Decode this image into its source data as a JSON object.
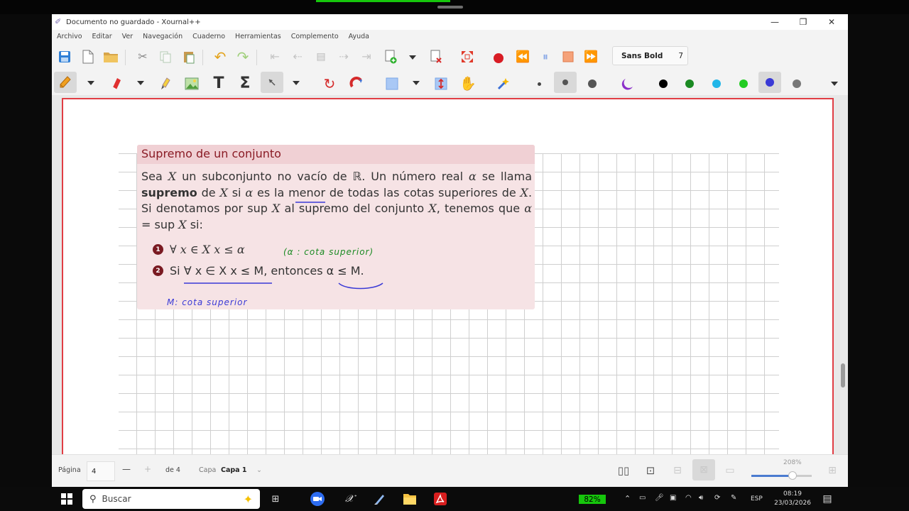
{
  "window": {
    "title": "Documento no guardado - Xournal++",
    "controls": {
      "minimize": "—",
      "restore": "❐",
      "close": "✕"
    }
  },
  "menu": [
    "Archivo",
    "Editar",
    "Ver",
    "Navegación",
    "Cuaderno",
    "Herramientas",
    "Complemento",
    "Ayuda"
  ],
  "toolbar": {
    "font_name": "Sans Bold",
    "font_size": "7",
    "pen_colors": [
      "#000000",
      "#1a8a22",
      "#22b6e8",
      "#22cc22",
      "#3a3ad6",
      "#777777"
    ],
    "selected_color": "#3a3ad6",
    "record_color": "#e01c24"
  },
  "definition": {
    "title": "Supremo de un conjunto",
    "body_html_parts": {
      "l1a": "Sea ",
      "X1": "X",
      "l1b": " un subconjunto no vacío de ℝ. Un número real ",
      "a1": "α",
      "l1c": " se llama",
      "bold": "supremo",
      "l2a": " de ",
      "X2": "X",
      "l2b": " si ",
      "a2": "α",
      "l2c": " es la menor de todas las cotas superiores de",
      "X3": "X",
      "l3a": ". Si denotamos por sup ",
      "X4": "X",
      "l3b": " al supremo del conjunto ",
      "X5": "X",
      "l3c": ", tenemos",
      "l4a": "que ",
      "a3": "α",
      "l4b": " = sup ",
      "X6": "X",
      "l4c": " si:"
    },
    "item1_num": "1",
    "item1_text": "∀ x ∈ X    x ≤ α",
    "item2_num": "2",
    "item2_text": "Si ∀ x ∈ X    x ≤ M, entonces α ≤ M."
  },
  "handwriting": {
    "note1": "(α : cota superior)",
    "note2": "M: cota superior"
  },
  "status": {
    "page_label": "Página",
    "page_value": "4",
    "page_minus": "—",
    "page_plus": "+",
    "page_of": "de 4",
    "layer_label": "Capa",
    "layer_value": "Capa 1",
    "zoom": "208%"
  },
  "taskbar": {
    "search_placeholder": "Buscar",
    "battery": "82%",
    "lang": "ESP",
    "time": "08:19",
    "date": "23/03/2026"
  }
}
